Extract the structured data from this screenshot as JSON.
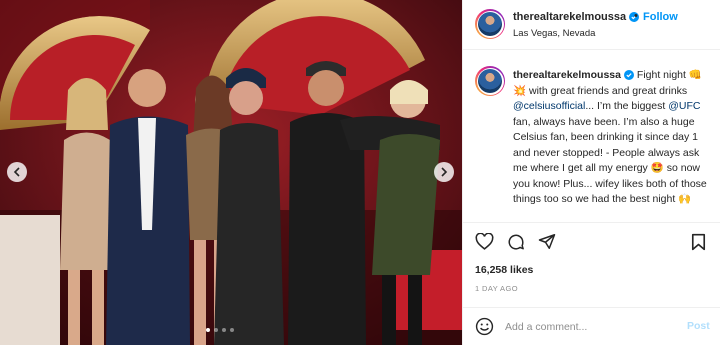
{
  "post": {
    "username": "therealtarekelmoussa",
    "follow_label": "Follow",
    "separator": "•",
    "more_label": "...",
    "location": "Las Vegas, Nevada",
    "caption": {
      "part1": " Fight night 👊 💥 with great friends and great drinks ",
      "mention1": "@celsiusofficial",
      "part2": "... I’m the biggest ",
      "mention2": "@UFC",
      "part3": " fan, always have been. I’m also a huge Celsius fan, been drinking it since day 1 and never stopped! - People always ask me where I get all my energy 🤩 so now you know! Plus... wifey likes both of those things too so we had the best night 🙌"
    },
    "likes": "16,258 likes",
    "time_ago": "1 DAY AGO",
    "comment_placeholder": "Add a comment...",
    "post_label": "Post"
  },
  "carousel": {
    "total": 4,
    "active": 0
  },
  "icons": {
    "verified": "verified-badge-icon",
    "like": "heart-icon",
    "comment": "comment-bubble-icon",
    "share": "paper-plane-icon",
    "save": "bookmark-icon",
    "emoji": "smiley-icon",
    "prev": "chevron-left-icon",
    "next": "chevron-right-icon"
  },
  "colors": {
    "link": "#0095f6",
    "mention": "#00376b",
    "text": "#262626",
    "muted": "#8e8e8e",
    "post_disabled": "#b2dffc",
    "verified": "#0095f6"
  }
}
